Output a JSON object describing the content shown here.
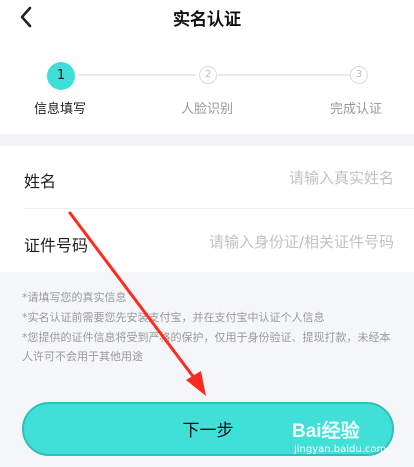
{
  "header": {
    "title": "实名认证",
    "back_icon": "chevron-left-icon"
  },
  "steps": [
    {
      "number": "1",
      "label": "信息填写",
      "active": true
    },
    {
      "number": "2",
      "label": "人脸识别",
      "active": false
    },
    {
      "number": "3",
      "label": "完成认证",
      "active": false
    }
  ],
  "form": {
    "name": {
      "label": "姓名",
      "placeholder": "请输入真实姓名",
      "value": ""
    },
    "id_number": {
      "label": "证件号码",
      "placeholder": "请输入身份证/相关证件号码",
      "value": ""
    }
  },
  "notes": [
    "*请填写您的真实信息",
    "*实名认证前需要您先安装支付宝，并在支付宝中认证个人信息",
    "*您提供的证件信息将受到严格的保护，仅用于身份验证、提现打款，未经本人许可不会用于其他用途"
  ],
  "next_button": {
    "label": "下一步"
  },
  "watermark": {
    "logo": "Bai经验",
    "url": "jingyan.baidu.com"
  },
  "colors": {
    "accent": "#40e0d8",
    "annotation_arrow": "#ff2a1f"
  }
}
